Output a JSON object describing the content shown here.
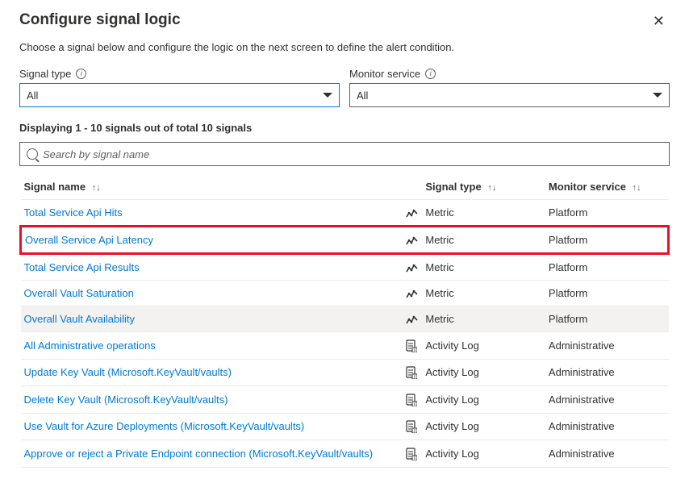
{
  "dialog": {
    "title": "Configure signal logic",
    "subtitle": "Choose a signal below and configure the logic on the next screen to define the alert condition."
  },
  "filters": {
    "signal_type": {
      "label": "Signal type",
      "value": "All"
    },
    "monitor_service": {
      "label": "Monitor service",
      "value": "All"
    }
  },
  "count_text": "Displaying 1 - 10 signals out of total 10 signals",
  "search": {
    "placeholder": "Search by signal name"
  },
  "columns": {
    "name": "Signal name",
    "type": "Signal type",
    "service": "Monitor service"
  },
  "rows": [
    {
      "name": "Total Service Api Hits",
      "icon": "metric",
      "type": "Metric",
      "service": "Platform",
      "highlighted": false,
      "hover": false
    },
    {
      "name": "Overall Service Api Latency",
      "icon": "metric",
      "type": "Metric",
      "service": "Platform",
      "highlighted": true,
      "hover": false
    },
    {
      "name": "Total Service Api Results",
      "icon": "metric",
      "type": "Metric",
      "service": "Platform",
      "highlighted": false,
      "hover": false
    },
    {
      "name": "Overall Vault Saturation",
      "icon": "metric",
      "type": "Metric",
      "service": "Platform",
      "highlighted": false,
      "hover": false
    },
    {
      "name": "Overall Vault Availability",
      "icon": "metric",
      "type": "Metric",
      "service": "Platform",
      "highlighted": false,
      "hover": true
    },
    {
      "name": "All Administrative operations",
      "icon": "activity",
      "type": "Activity Log",
      "service": "Administrative",
      "highlighted": false,
      "hover": false
    },
    {
      "name": "Update Key Vault (Microsoft.KeyVault/vaults)",
      "icon": "activity",
      "type": "Activity Log",
      "service": "Administrative",
      "highlighted": false,
      "hover": false
    },
    {
      "name": "Delete Key Vault (Microsoft.KeyVault/vaults)",
      "icon": "activity",
      "type": "Activity Log",
      "service": "Administrative",
      "highlighted": false,
      "hover": false
    },
    {
      "name": "Use Vault for Azure Deployments (Microsoft.KeyVault/vaults)",
      "icon": "activity",
      "type": "Activity Log",
      "service": "Administrative",
      "highlighted": false,
      "hover": false
    },
    {
      "name": "Approve or reject a Private Endpoint connection (Microsoft.KeyVault/vaults)",
      "icon": "activity",
      "type": "Activity Log",
      "service": "Administrative",
      "highlighted": false,
      "hover": false
    }
  ]
}
